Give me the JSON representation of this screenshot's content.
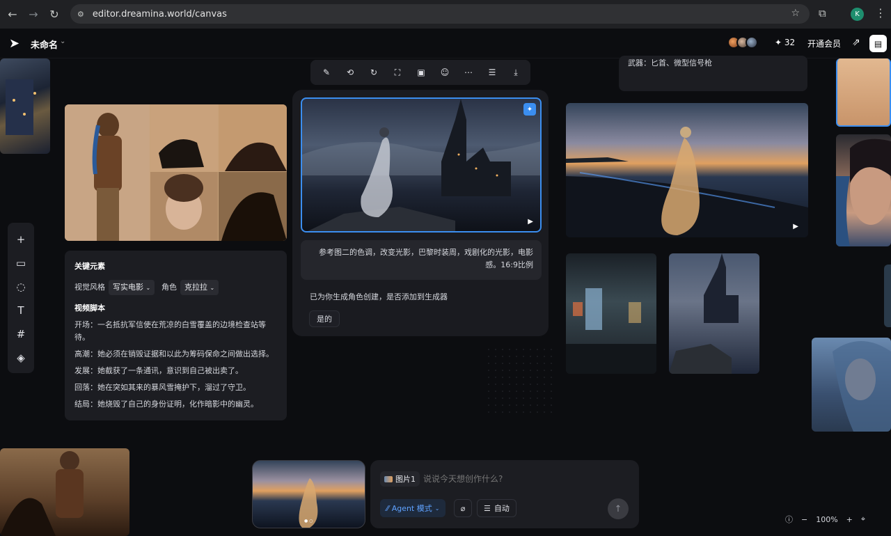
{
  "browser": {
    "url": "editor.dreamina.world/canvas",
    "profile_initial": "K"
  },
  "appbar": {
    "title": "未命名",
    "credits": "32",
    "vip_label": "开通会员"
  },
  "card_top_text": "武器：匕首、微型信号枪",
  "key_elements": {
    "heading": "关键元素",
    "style_label": "视觉风格",
    "style_value": "写实电影",
    "role_label": "角色",
    "role_value": "克拉拉",
    "script_heading": "视频脚本",
    "lines": [
      "开场：一名抵抗军信使在荒凉的白雪覆盖的边境检查站等",
      "待。",
      "高潮：她必须在销毁证据和以此为筹码保命之间做出选择。",
      "发展：她截获了一条通讯，意识到自己被出卖了。",
      "回落：她在突如其来的暴风雪掩护下，溜过了守卫。",
      "结局：她烧毁了自己的身份证明，化作暗影中的幽灵。"
    ]
  },
  "chat": {
    "prompt_line1": "参考图二的色调，改变光影，巴黎时装周，戏剧化的光影，电影",
    "prompt_line2": "感。16:9比例",
    "reply": "已为你生成角色创建，是否添加到生成器",
    "yes_button": "是的"
  },
  "input": {
    "image_chip": "图片1",
    "placeholder": "说说今天想创作什么?",
    "agent_mode": "Agent 模式",
    "auto": "自动"
  },
  "zoom": "100%",
  "colors": {
    "accent": "#3b8ef0",
    "canvas_bg": "#0c0d10",
    "card_bg": "#1c1d22"
  }
}
